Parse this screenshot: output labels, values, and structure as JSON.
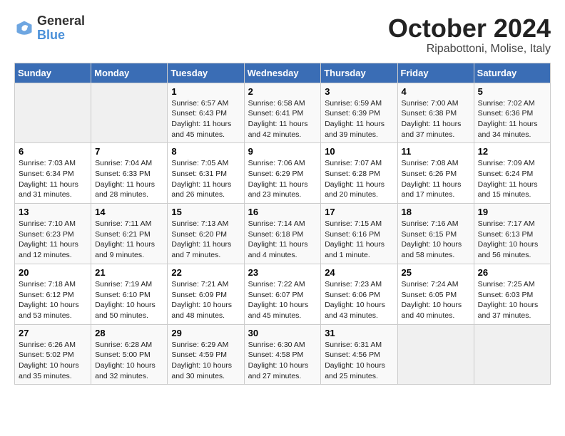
{
  "header": {
    "logo": {
      "general": "General",
      "blue": "Blue"
    },
    "title": "October 2024",
    "subtitle": "Ripabottoni, Molise, Italy"
  },
  "weekdays": [
    "Sunday",
    "Monday",
    "Tuesday",
    "Wednesday",
    "Thursday",
    "Friday",
    "Saturday"
  ],
  "weeks": [
    [
      {
        "day": null
      },
      {
        "day": null
      },
      {
        "day": "1",
        "sunrise": "Sunrise: 6:57 AM",
        "sunset": "Sunset: 6:43 PM",
        "daylight": "Daylight: 11 hours and 45 minutes."
      },
      {
        "day": "2",
        "sunrise": "Sunrise: 6:58 AM",
        "sunset": "Sunset: 6:41 PM",
        "daylight": "Daylight: 11 hours and 42 minutes."
      },
      {
        "day": "3",
        "sunrise": "Sunrise: 6:59 AM",
        "sunset": "Sunset: 6:39 PM",
        "daylight": "Daylight: 11 hours and 39 minutes."
      },
      {
        "day": "4",
        "sunrise": "Sunrise: 7:00 AM",
        "sunset": "Sunset: 6:38 PM",
        "daylight": "Daylight: 11 hours and 37 minutes."
      },
      {
        "day": "5",
        "sunrise": "Sunrise: 7:02 AM",
        "sunset": "Sunset: 6:36 PM",
        "daylight": "Daylight: 11 hours and 34 minutes."
      }
    ],
    [
      {
        "day": "6",
        "sunrise": "Sunrise: 7:03 AM",
        "sunset": "Sunset: 6:34 PM",
        "daylight": "Daylight: 11 hours and 31 minutes."
      },
      {
        "day": "7",
        "sunrise": "Sunrise: 7:04 AM",
        "sunset": "Sunset: 6:33 PM",
        "daylight": "Daylight: 11 hours and 28 minutes."
      },
      {
        "day": "8",
        "sunrise": "Sunrise: 7:05 AM",
        "sunset": "Sunset: 6:31 PM",
        "daylight": "Daylight: 11 hours and 26 minutes."
      },
      {
        "day": "9",
        "sunrise": "Sunrise: 7:06 AM",
        "sunset": "Sunset: 6:29 PM",
        "daylight": "Daylight: 11 hours and 23 minutes."
      },
      {
        "day": "10",
        "sunrise": "Sunrise: 7:07 AM",
        "sunset": "Sunset: 6:28 PM",
        "daylight": "Daylight: 11 hours and 20 minutes."
      },
      {
        "day": "11",
        "sunrise": "Sunrise: 7:08 AM",
        "sunset": "Sunset: 6:26 PM",
        "daylight": "Daylight: 11 hours and 17 minutes."
      },
      {
        "day": "12",
        "sunrise": "Sunrise: 7:09 AM",
        "sunset": "Sunset: 6:24 PM",
        "daylight": "Daylight: 11 hours and 15 minutes."
      }
    ],
    [
      {
        "day": "13",
        "sunrise": "Sunrise: 7:10 AM",
        "sunset": "Sunset: 6:23 PM",
        "daylight": "Daylight: 11 hours and 12 minutes."
      },
      {
        "day": "14",
        "sunrise": "Sunrise: 7:11 AM",
        "sunset": "Sunset: 6:21 PM",
        "daylight": "Daylight: 11 hours and 9 minutes."
      },
      {
        "day": "15",
        "sunrise": "Sunrise: 7:13 AM",
        "sunset": "Sunset: 6:20 PM",
        "daylight": "Daylight: 11 hours and 7 minutes."
      },
      {
        "day": "16",
        "sunrise": "Sunrise: 7:14 AM",
        "sunset": "Sunset: 6:18 PM",
        "daylight": "Daylight: 11 hours and 4 minutes."
      },
      {
        "day": "17",
        "sunrise": "Sunrise: 7:15 AM",
        "sunset": "Sunset: 6:16 PM",
        "daylight": "Daylight: 11 hours and 1 minute."
      },
      {
        "day": "18",
        "sunrise": "Sunrise: 7:16 AM",
        "sunset": "Sunset: 6:15 PM",
        "daylight": "Daylight: 10 hours and 58 minutes."
      },
      {
        "day": "19",
        "sunrise": "Sunrise: 7:17 AM",
        "sunset": "Sunset: 6:13 PM",
        "daylight": "Daylight: 10 hours and 56 minutes."
      }
    ],
    [
      {
        "day": "20",
        "sunrise": "Sunrise: 7:18 AM",
        "sunset": "Sunset: 6:12 PM",
        "daylight": "Daylight: 10 hours and 53 minutes."
      },
      {
        "day": "21",
        "sunrise": "Sunrise: 7:19 AM",
        "sunset": "Sunset: 6:10 PM",
        "daylight": "Daylight: 10 hours and 50 minutes."
      },
      {
        "day": "22",
        "sunrise": "Sunrise: 7:21 AM",
        "sunset": "Sunset: 6:09 PM",
        "daylight": "Daylight: 10 hours and 48 minutes."
      },
      {
        "day": "23",
        "sunrise": "Sunrise: 7:22 AM",
        "sunset": "Sunset: 6:07 PM",
        "daylight": "Daylight: 10 hours and 45 minutes."
      },
      {
        "day": "24",
        "sunrise": "Sunrise: 7:23 AM",
        "sunset": "Sunset: 6:06 PM",
        "daylight": "Daylight: 10 hours and 43 minutes."
      },
      {
        "day": "25",
        "sunrise": "Sunrise: 7:24 AM",
        "sunset": "Sunset: 6:05 PM",
        "daylight": "Daylight: 10 hours and 40 minutes."
      },
      {
        "day": "26",
        "sunrise": "Sunrise: 7:25 AM",
        "sunset": "Sunset: 6:03 PM",
        "daylight": "Daylight: 10 hours and 37 minutes."
      }
    ],
    [
      {
        "day": "27",
        "sunrise": "Sunrise: 6:26 AM",
        "sunset": "Sunset: 5:02 PM",
        "daylight": "Daylight: 10 hours and 35 minutes."
      },
      {
        "day": "28",
        "sunrise": "Sunrise: 6:28 AM",
        "sunset": "Sunset: 5:00 PM",
        "daylight": "Daylight: 10 hours and 32 minutes."
      },
      {
        "day": "29",
        "sunrise": "Sunrise: 6:29 AM",
        "sunset": "Sunset: 4:59 PM",
        "daylight": "Daylight: 10 hours and 30 minutes."
      },
      {
        "day": "30",
        "sunrise": "Sunrise: 6:30 AM",
        "sunset": "Sunset: 4:58 PM",
        "daylight": "Daylight: 10 hours and 27 minutes."
      },
      {
        "day": "31",
        "sunrise": "Sunrise: 6:31 AM",
        "sunset": "Sunset: 4:56 PM",
        "daylight": "Daylight: 10 hours and 25 minutes."
      },
      {
        "day": null
      },
      {
        "day": null
      }
    ]
  ]
}
